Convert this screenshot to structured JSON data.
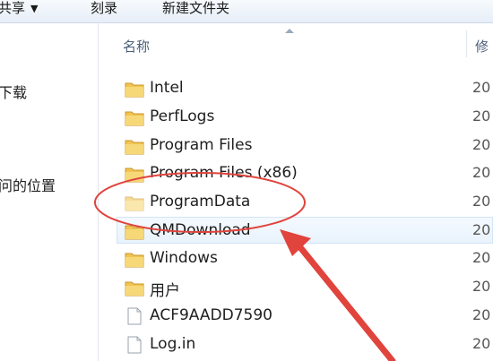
{
  "toolbar": {
    "share_label": "共享",
    "share_arrow": "▼",
    "burn_label": "刻录",
    "new_folder_label": "新建文件夹"
  },
  "nav": {
    "items": [
      {
        "label": "下载"
      },
      {
        "label": "问的位置"
      }
    ]
  },
  "list": {
    "header": {
      "name_label": "名称",
      "modified_label": "修"
    },
    "files": [
      {
        "name": "Intel",
        "date": "20",
        "icon": "folder-icon"
      },
      {
        "name": "PerfLogs",
        "date": "20",
        "icon": "folder-icon"
      },
      {
        "name": "Program Files",
        "date": "20",
        "icon": "folder-icon"
      },
      {
        "name": "Program Files (x86)",
        "date": "20",
        "icon": "folder-icon"
      },
      {
        "name": "ProgramData",
        "date": "20",
        "icon": "folder-icon"
      },
      {
        "name": "QMDownload",
        "date": "20",
        "icon": "folder-icon"
      },
      {
        "name": "Windows",
        "date": "20",
        "icon": "folder-icon"
      },
      {
        "name": "用户",
        "date": "20",
        "icon": "folder-icon"
      },
      {
        "name": "ACF9AADD7590",
        "date": "20",
        "icon": "file-icon"
      },
      {
        "name": "Log.in",
        "date": "20",
        "icon": "file-icon"
      }
    ]
  },
  "colors": {
    "annotation_red": "#e0443c",
    "folder_yellow": "#f1c452",
    "hover_blue": "#d2e4f6"
  }
}
